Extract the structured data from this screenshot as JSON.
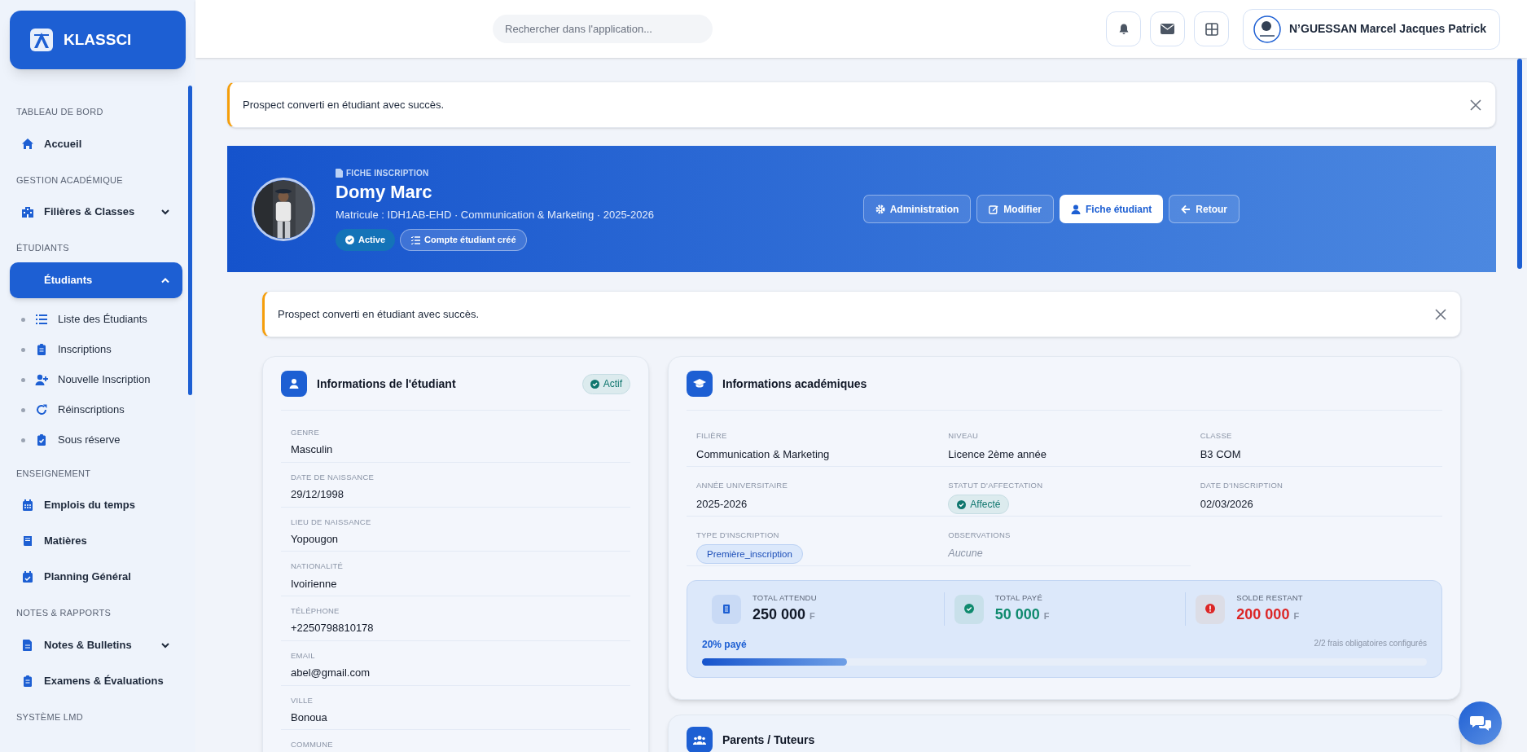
{
  "sidebar": {
    "brand": "KLASSCI",
    "sections": [
      {
        "title": "TABLEAU DE BORD",
        "items": [
          {
            "label": "Accueil",
            "kind": "link",
            "selected": false
          }
        ]
      },
      {
        "title": "GESTION ACADÉMIQUE",
        "items": [
          {
            "label": "Filières & Classes",
            "kind": "group",
            "expanded": false,
            "selected": false
          }
        ]
      },
      {
        "title": "ÉTUDIANTS",
        "items": [
          {
            "label": "Étudiants",
            "kind": "group",
            "expanded": true,
            "selected": true,
            "children": [
              {
                "label": "Liste des Étudiants",
                "selected": false
              },
              {
                "label": "Inscriptions",
                "selected": false
              },
              {
                "label": "Nouvelle Inscription",
                "selected": false
              },
              {
                "label": "Réinscriptions",
                "selected": false
              },
              {
                "label": "Sous réserve",
                "selected": false
              }
            ]
          }
        ]
      },
      {
        "title": "ENSEIGNEMENT",
        "items": [
          {
            "label": "Emplois du temps",
            "kind": "link",
            "selected": false
          },
          {
            "label": "Matières",
            "kind": "link",
            "selected": false
          },
          {
            "label": "Planning Général",
            "kind": "link",
            "selected": false
          }
        ]
      },
      {
        "title": "NOTES & RAPPORTS",
        "items": [
          {
            "label": "Notes & Bulletins",
            "kind": "group",
            "expanded": false,
            "selected": false
          },
          {
            "label": "Examens & Évaluations",
            "kind": "link",
            "selected": false
          }
        ]
      },
      {
        "title": "SYSTÈME LMD"
      }
    ]
  },
  "header": {
    "search": {
      "placeholder": "Rechercher dans l'application..."
    },
    "user": "N’GUESSAN Marcel Jacques Patrick"
  },
  "alerts": [
    {
      "message": "Prospect converti en étudiant avec succès."
    }
  ],
  "profile": {
    "eyebrow": "FICHE INSCRIPTION",
    "name": "Domy Marc",
    "subtitle": "Matricule : IDH1AB-EHD · Communication & Marketing · 2025-2026",
    "badges": [
      {
        "label": "Active",
        "kind": "status"
      },
      {
        "label": "Compte étudiant créé",
        "kind": "outline"
      }
    ],
    "buttons": [
      {
        "label": "Administration",
        "selected": false
      },
      {
        "label": "Modifier",
        "selected": false
      },
      {
        "label": "Fiche étudiant",
        "selected": true
      },
      {
        "label": "Retour",
        "selected": false
      }
    ]
  },
  "inner_alerts": [
    {
      "message": "Prospect converti en étudiant avec succès."
    }
  ],
  "student_card": {
    "title": "Informations de l'étudiant",
    "badge": "Actif",
    "fields": [
      {
        "label": "GENRE",
        "value": "Masculin"
      },
      {
        "label": "DATE DE NAISSANCE",
        "value": "29/12/1998"
      },
      {
        "label": "LIEU DE NAISSANCE",
        "value": "Yopougon"
      },
      {
        "label": "NATIONALITÉ",
        "value": "Ivoirienne"
      },
      {
        "label": "TÉLÉPHONE",
        "value": "+2250798810178"
      },
      {
        "label": "EMAIL",
        "value": "abel@gmail.com"
      },
      {
        "label": "VILLE",
        "value": "Bonoua"
      },
      {
        "label": "COMMUNE"
      }
    ]
  },
  "academic_card": {
    "title": "Informations académiques",
    "fields": [
      {
        "label": "FILIÈRE",
        "value": "Communication & Marketing",
        "kind": "text"
      },
      {
        "label": "NIVEAU",
        "value": "Licence 2ème année",
        "kind": "text"
      },
      {
        "label": "CLASSE",
        "value": "B3 COM",
        "kind": "text"
      },
      {
        "label": "ANNÉE UNIVERSITAIRE",
        "value": "2025-2026",
        "kind": "text"
      },
      {
        "label": "STATUT D'AFFECTATION",
        "value": "Affecté",
        "kind": "status"
      },
      {
        "label": "DATE D'INSCRIPTION",
        "value": "02/03/2026",
        "kind": "text"
      },
      {
        "label": "TYPE D'INSCRIPTION",
        "value": "Première_inscription",
        "kind": "tag"
      },
      {
        "label": "OBSERVATIONS",
        "value": "Aucune",
        "kind": "muted"
      }
    ],
    "totals": [
      {
        "label": "TOTAL ATTENDU",
        "amount": "250 000",
        "currency": "F",
        "kind": "neutral"
      },
      {
        "label": "TOTAL PAYÉ",
        "amount": "50 000",
        "currency": "F",
        "kind": "success"
      },
      {
        "label": "SOLDE RESTANT",
        "amount": "200 000",
        "currency": "F",
        "kind": "danger"
      }
    ],
    "progress": {
      "label": "20% payé",
      "level": 0.2,
      "note": "2/2 frais obligatoires configurés"
    }
  },
  "parents_card": {
    "title": "Parents / Tuteurs"
  }
}
